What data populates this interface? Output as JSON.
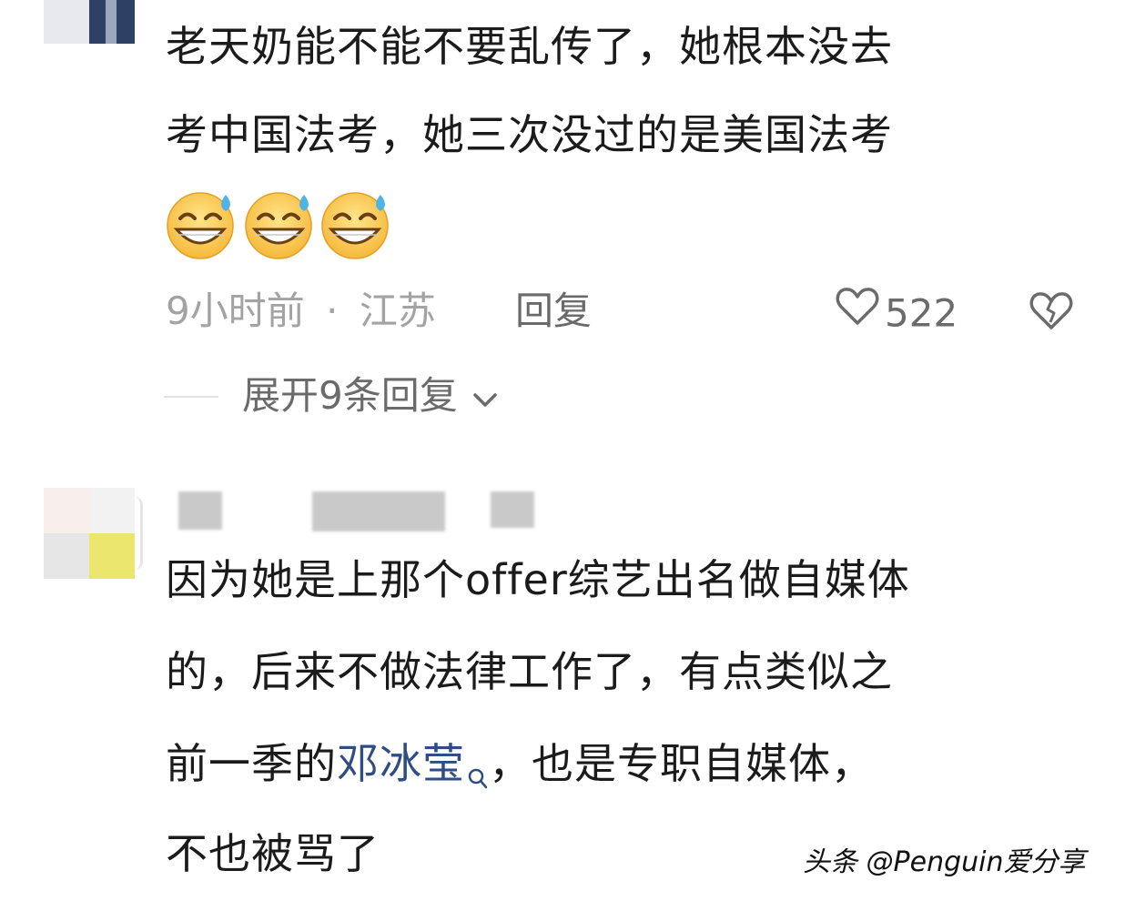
{
  "comment1": {
    "lines": [
      "老天奶能不能不要乱传了，她根本没去",
      "考中国法考，她三次没过的是美国法考"
    ],
    "emoji_count_label": "😅😅😅",
    "time": "9小时前",
    "separator": "·",
    "location": "江苏",
    "reply_label": "回复",
    "likes": "522",
    "expand_label": "展开9条回复"
  },
  "comment2": {
    "line1": "因为她是上那个offer综艺出名做自媒体",
    "line2": "的，后来不做法律工作了，有点类似之",
    "line3_before": "前一季的",
    "line3_link": "邓冰莹",
    "line3_after": "，也是专职自媒体，",
    "line4": "不也被骂了"
  },
  "watermark": "头条 @Penguin爱分享",
  "colors": {
    "text": "#1b1b1b",
    "meta_gray": "#a3a3a3",
    "link_blue": "#2f4d84"
  },
  "icons": [
    "sweat-smile-emoji",
    "heart-outline-icon",
    "broken-heart-icon",
    "chevron-down-icon",
    "search-icon"
  ]
}
